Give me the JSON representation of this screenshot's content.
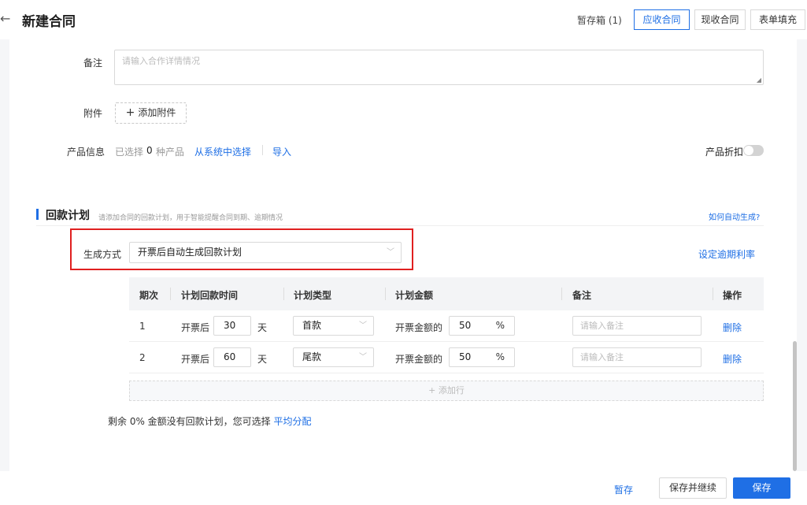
{
  "header": {
    "back_icon": "←",
    "title": "新建合同",
    "draft_box": "暂存箱 (1)",
    "tabs": [
      {
        "label": "应收合同",
        "active": true
      },
      {
        "label": "现收合同",
        "active": false
      },
      {
        "label": "表单填充",
        "active": false
      }
    ]
  },
  "form": {
    "remark_label": "备注",
    "remark_placeholder": "请输入合作详情情况",
    "attachment_label": "附件",
    "attachment_button": "添加附件",
    "product_label": "产品信息",
    "product_selected_prefix": "已选择",
    "product_count": "0",
    "product_unit": "种产品",
    "product_select_link": "从系统中选择",
    "product_import_link": "导入",
    "product_discount_label": "产品折扣",
    "product_discount_on": false
  },
  "payment_plan": {
    "title": "回款计划",
    "hint": "请添加合同的回款计划，用于智能提醒合同到期、逾期情况",
    "help_link": "如何自动生成?",
    "gen_label": "生成方式",
    "gen_value": "开票后自动生成回款计划",
    "overdue_link": "设定逾期利率",
    "columns": [
      "期次",
      "计划回款时间",
      "计划类型",
      "计划金额",
      "备注",
      "操作"
    ],
    "rows": [
      {
        "no": "1",
        "time_prefix": "开票后",
        "days": "30",
        "time_unit": "天",
        "type": "首款",
        "amount_prefix": "开票金额的",
        "percent": "50",
        "pct": "%",
        "note_placeholder": "请输入备注",
        "action": "删除"
      },
      {
        "no": "2",
        "time_prefix": "开票后",
        "days": "60",
        "time_unit": "天",
        "type": "尾款",
        "amount_prefix": "开票金额的",
        "percent": "50",
        "pct": "%",
        "note_placeholder": "请输入备注",
        "action": "删除"
      }
    ],
    "add_row": "+ 添加行",
    "remain_text": "剩余 0% 金额没有回款计划，您可选择",
    "average_link": "平均分配"
  },
  "footer": {
    "draft": "暂存",
    "save_continue": "保存并继续",
    "save": "保存"
  },
  "colors": {
    "accent": "#1f6fe5",
    "highlight": "#e02020"
  }
}
